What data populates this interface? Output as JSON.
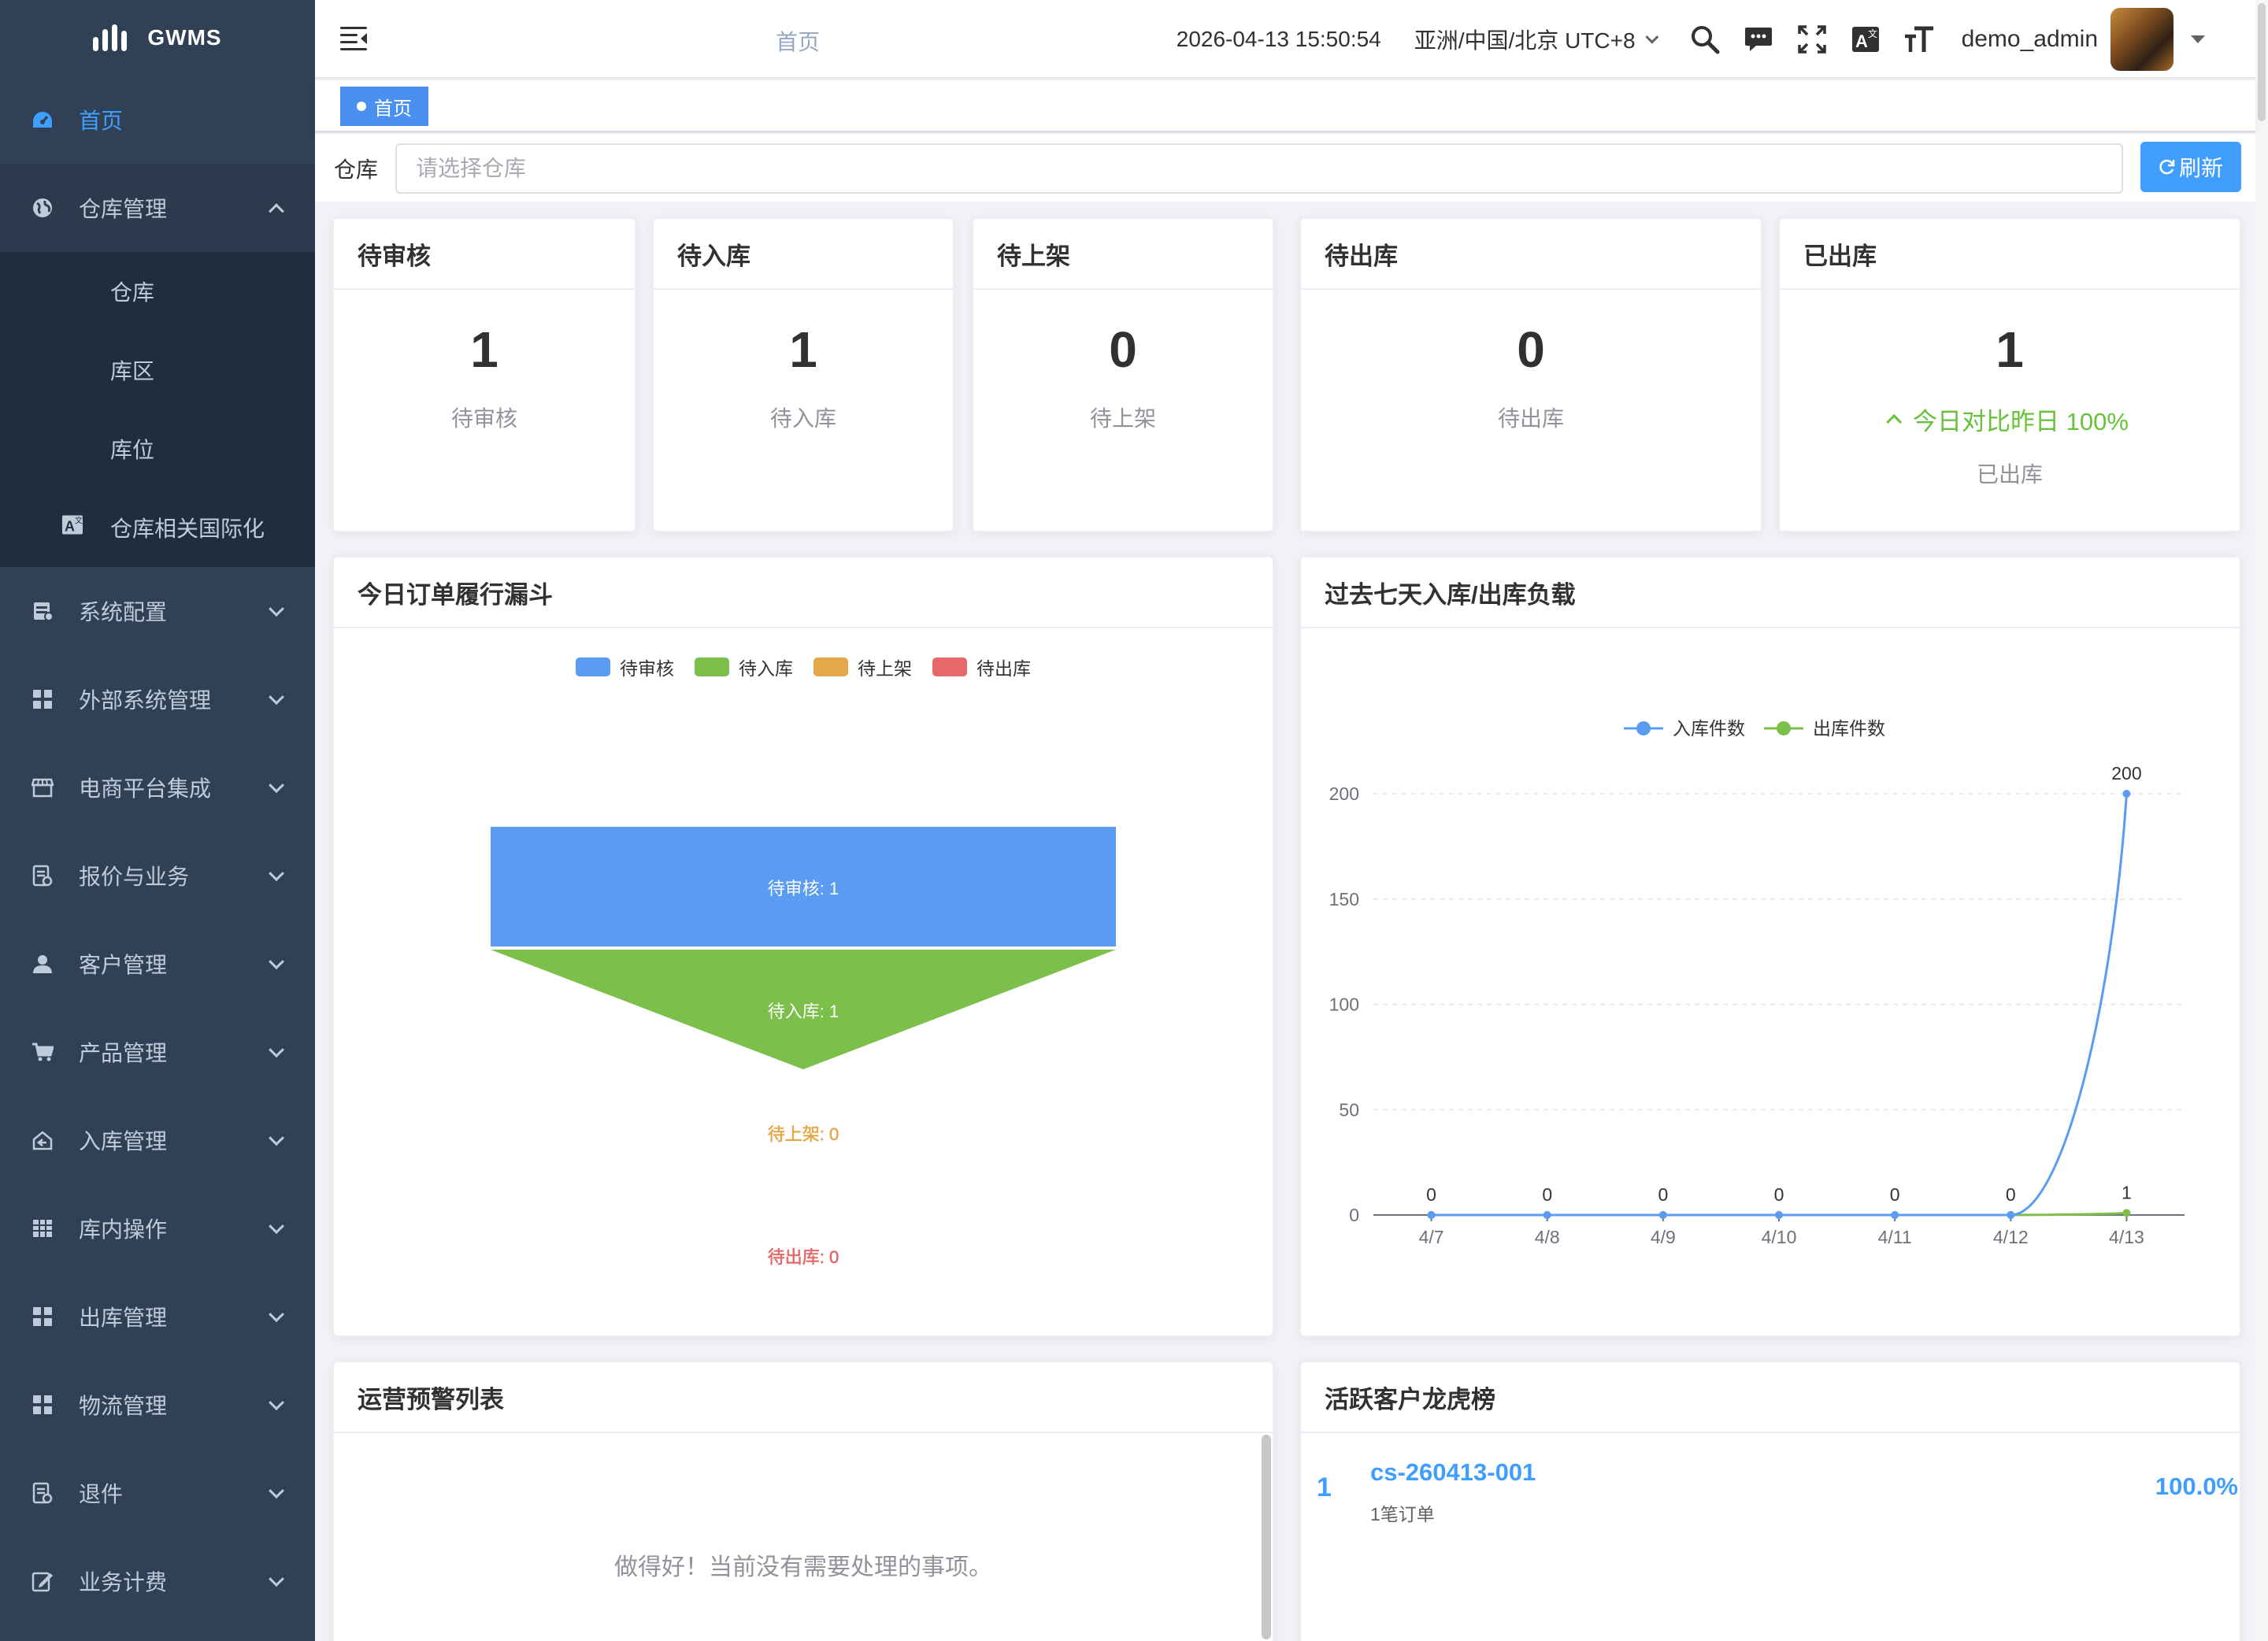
{
  "app": {
    "name": "GWMS"
  },
  "sidebar": {
    "items": [
      {
        "label": "首页",
        "icon": "dashboard-icon",
        "active": true
      },
      {
        "label": "仓库管理",
        "icon": "globe-icon",
        "expanded": true,
        "children": [
          {
            "label": "仓库"
          },
          {
            "label": "库区"
          },
          {
            "label": "库位"
          },
          {
            "label": "仓库相关国际化",
            "icon": "translate-icon"
          }
        ]
      },
      {
        "label": "系统配置",
        "icon": "server-icon"
      },
      {
        "label": "外部系统管理",
        "icon": "grid-icon"
      },
      {
        "label": "电商平台集成",
        "icon": "shop-icon"
      },
      {
        "label": "报价与业务",
        "icon": "document-icon"
      },
      {
        "label": "客户管理",
        "icon": "user-icon"
      },
      {
        "label": "产品管理",
        "icon": "cart-icon"
      },
      {
        "label": "入库管理",
        "icon": "home-icon"
      },
      {
        "label": "库内操作",
        "icon": "table-icon"
      },
      {
        "label": "出库管理",
        "icon": "grid-icon"
      },
      {
        "label": "物流管理",
        "icon": "grid-icon"
      },
      {
        "label": "退件",
        "icon": "document-icon"
      },
      {
        "label": "业务计费",
        "icon": "edit-icon"
      }
    ]
  },
  "header": {
    "breadcrumb": "首页",
    "datetime": "2026-04-13 15:50:54",
    "timezone": "亚洲/中国/北京 UTC+8",
    "username": "demo_admin",
    "icons": [
      "search-icon",
      "message-icon",
      "fullscreen-icon",
      "translate-icon",
      "font-size-icon"
    ]
  },
  "tags": [
    {
      "label": "首页",
      "active": true
    }
  ],
  "filter": {
    "label": "仓库",
    "placeholder": "请选择仓库",
    "refresh_label": "刷新"
  },
  "stats": [
    {
      "title": "待审核",
      "value": "1",
      "label": "待审核"
    },
    {
      "title": "待入库",
      "value": "1",
      "label": "待入库"
    },
    {
      "title": "待上架",
      "value": "0",
      "label": "待上架"
    },
    {
      "title": "待出库",
      "value": "0",
      "label": "待出库"
    },
    {
      "title": "已出库",
      "value": "1",
      "trend": "今日对比昨日 100%",
      "label": "已出库"
    }
  ],
  "funnel": {
    "title": "今日订单履行漏斗"
  },
  "line": {
    "title": "过去七天入库/出库负载"
  },
  "alerts": {
    "title": "运营预警列表",
    "empty": "做得好！当前没有需要处理的事项。"
  },
  "ranking": {
    "title": "活跃客户龙虎榜",
    "rows": [
      {
        "rank": "1",
        "name": "cs-260413-001",
        "meta": "1笔订单",
        "pct": "100.0%"
      }
    ]
  },
  "colors": {
    "primary": "#409eff",
    "sidebar": "#304156",
    "green": "#67c23a"
  },
  "chart_data": [
    {
      "type": "funnel",
      "series": [
        {
          "name": "待审核",
          "value": 1,
          "color": "#5b9cf3"
        },
        {
          "name": "待入库",
          "value": 1,
          "color": "#7cc04b"
        },
        {
          "name": "待上架",
          "value": 0,
          "color": "#e5a84b"
        },
        {
          "name": "待出库",
          "value": 0,
          "color": "#e5696a"
        }
      ],
      "legend": "top-center"
    },
    {
      "type": "line",
      "categories": [
        "4/7",
        "4/8",
        "4/9",
        "4/10",
        "4/11",
        "4/12",
        "4/13"
      ],
      "ylim": [
        0,
        200
      ],
      "yticks": [
        0,
        50,
        100,
        150,
        200
      ],
      "series": [
        {
          "name": "入库件数",
          "values": [
            0,
            0,
            0,
            0,
            0,
            0,
            200
          ],
          "color": "#5b9cf3"
        },
        {
          "name": "出库件数",
          "values": [
            0,
            0,
            0,
            0,
            0,
            0,
            1
          ],
          "color": "#7cc04b"
        }
      ],
      "legend": "top-center",
      "grid": true
    }
  ]
}
